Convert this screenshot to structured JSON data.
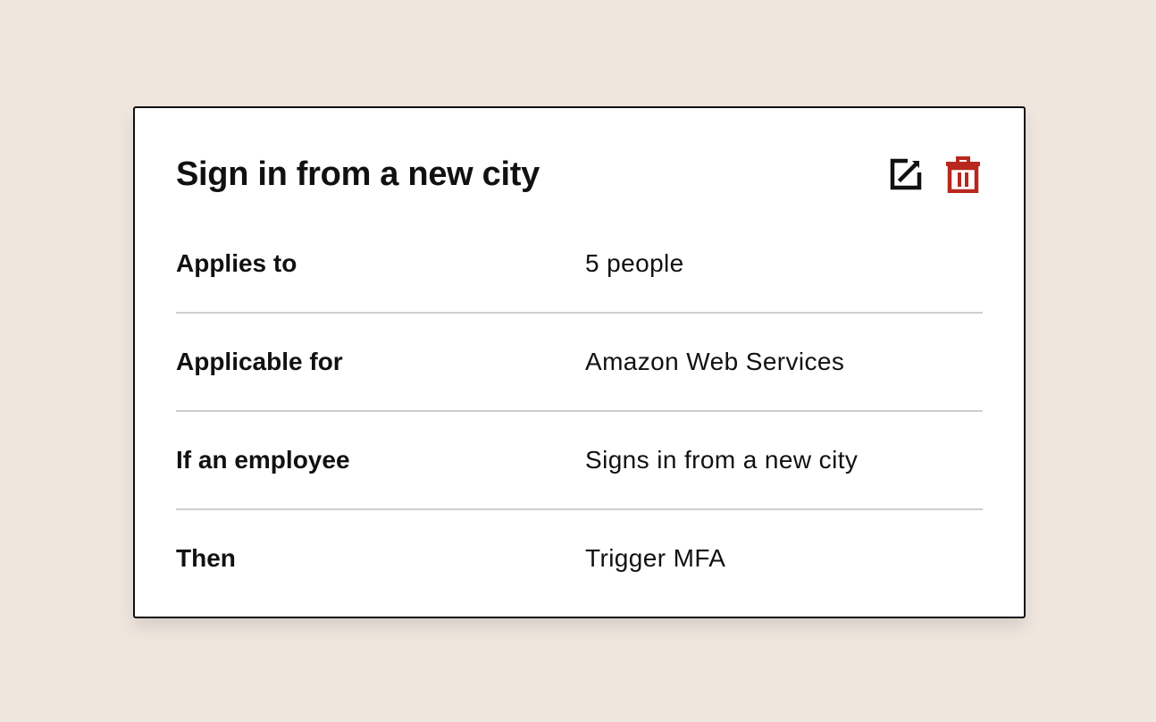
{
  "colors": {
    "background": "#efe6de",
    "card": "#ffffff",
    "text": "#111111",
    "divider": "#cfcfcf",
    "delete": "#b8281e"
  },
  "rule": {
    "title": "Sign in from a new city",
    "actions": {
      "edit_icon": "edit-icon",
      "delete_icon": "trash-icon"
    },
    "rows": [
      {
        "label": "Applies to",
        "value": "5 people"
      },
      {
        "label": "Applicable for",
        "value": "Amazon Web Services"
      },
      {
        "label": "If an employee",
        "value": "Signs in from a new city"
      },
      {
        "label": "Then",
        "value": "Trigger MFA"
      }
    ]
  }
}
